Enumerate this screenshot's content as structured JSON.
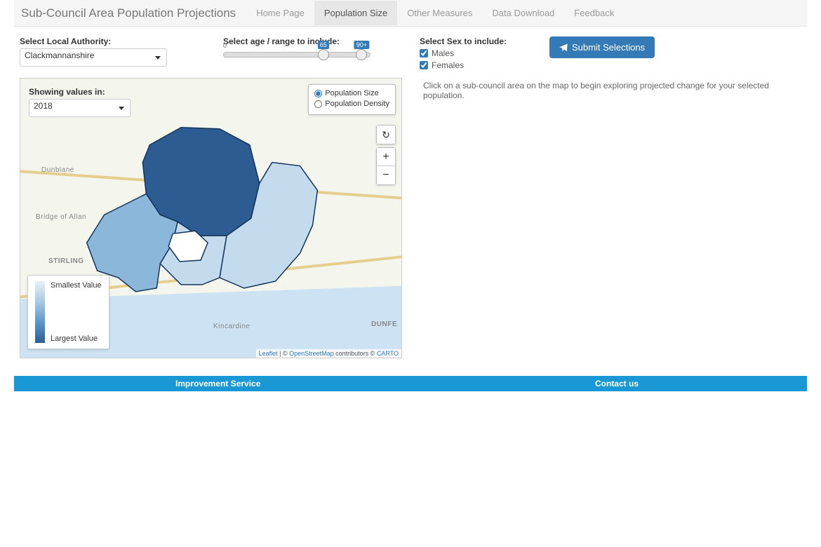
{
  "navbar": {
    "brand": "Sub-Council Area Population Projections",
    "items": [
      {
        "label": "Home Page",
        "active": false
      },
      {
        "label": "Population Size",
        "active": true
      },
      {
        "label": "Other Measures",
        "active": false
      },
      {
        "label": "Data Download",
        "active": false
      },
      {
        "label": "Feedback",
        "active": false
      }
    ]
  },
  "controls": {
    "local_authority": {
      "label": "Select Local Authority:",
      "value": "Clackmannanshire"
    },
    "age": {
      "label": "Select age / range to include:",
      "min_label": "0",
      "low": "65",
      "high": "90+",
      "low_pct": 68,
      "high_pct": 94
    },
    "sex": {
      "label": "Select Sex to include:",
      "males": "Males",
      "females": "Females"
    },
    "submit": "Submit Selections"
  },
  "map": {
    "year_label": "Showing values in:",
    "year_value": "2018",
    "radio_size": "Population Size",
    "radio_density": "Population Density",
    "legend_smallest": "Smallest Value",
    "legend_largest": "Largest Value",
    "attribution": {
      "leaflet": "Leaflet",
      "sep1": " | © ",
      "osm": "OpenStreetMap",
      "sep2": " contributors © ",
      "carto": "CARTO"
    },
    "place_labels": {
      "stirling": "STIRLING",
      "dunblane": "Dunblane",
      "bridge": "Bridge of Allan",
      "kincardine": "Kincardine",
      "dunfermline": "DUNFE"
    }
  },
  "hint": "Click on a sub-council area on the map to begin exploring projected change for your selected population.",
  "footer": {
    "left": "Improvement Service",
    "right": "Contact us"
  }
}
